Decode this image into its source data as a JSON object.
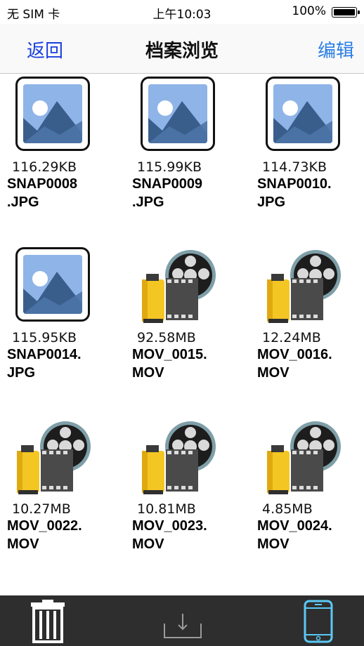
{
  "status_bar": {
    "carrier": "无 SIM 卡",
    "time": "上午10:03",
    "battery": "100%"
  },
  "nav": {
    "back_label": "返回",
    "title": "档案浏览",
    "edit_label": "编辑"
  },
  "files": [
    {
      "size": "116.29KB",
      "name": "SNAP0008\n.JPG",
      "kind": "image"
    },
    {
      "size": "115.99KB",
      "name": "SNAP0009\n.JPG",
      "kind": "image"
    },
    {
      "size": "114.73KB",
      "name": "SNAP0010.\nJPG",
      "kind": "image"
    },
    {
      "size": "115.95KB",
      "name": "SNAP0014.\nJPG",
      "kind": "image"
    },
    {
      "size": "92.58MB",
      "name": "MOV_0015.\nMOV",
      "kind": "video"
    },
    {
      "size": "12.24MB",
      "name": "MOV_0016.\nMOV",
      "kind": "video"
    },
    {
      "size": "10.27MB",
      "name": "MOV_0022.\nMOV",
      "kind": "video"
    },
    {
      "size": "10.81MB",
      "name": "MOV_0023.\nMOV",
      "kind": "video"
    },
    {
      "size": "4.85MB",
      "name": "MOV_0024.\nMOV",
      "kind": "video"
    }
  ],
  "toolbar": {
    "icons": [
      "trash-icon",
      "download-icon",
      "phone-icon"
    ]
  },
  "colors": {
    "nav_link": "#1a3fe0",
    "edit_link": "#2a7ee6",
    "toolbar_bg": "#2e2e2e"
  }
}
